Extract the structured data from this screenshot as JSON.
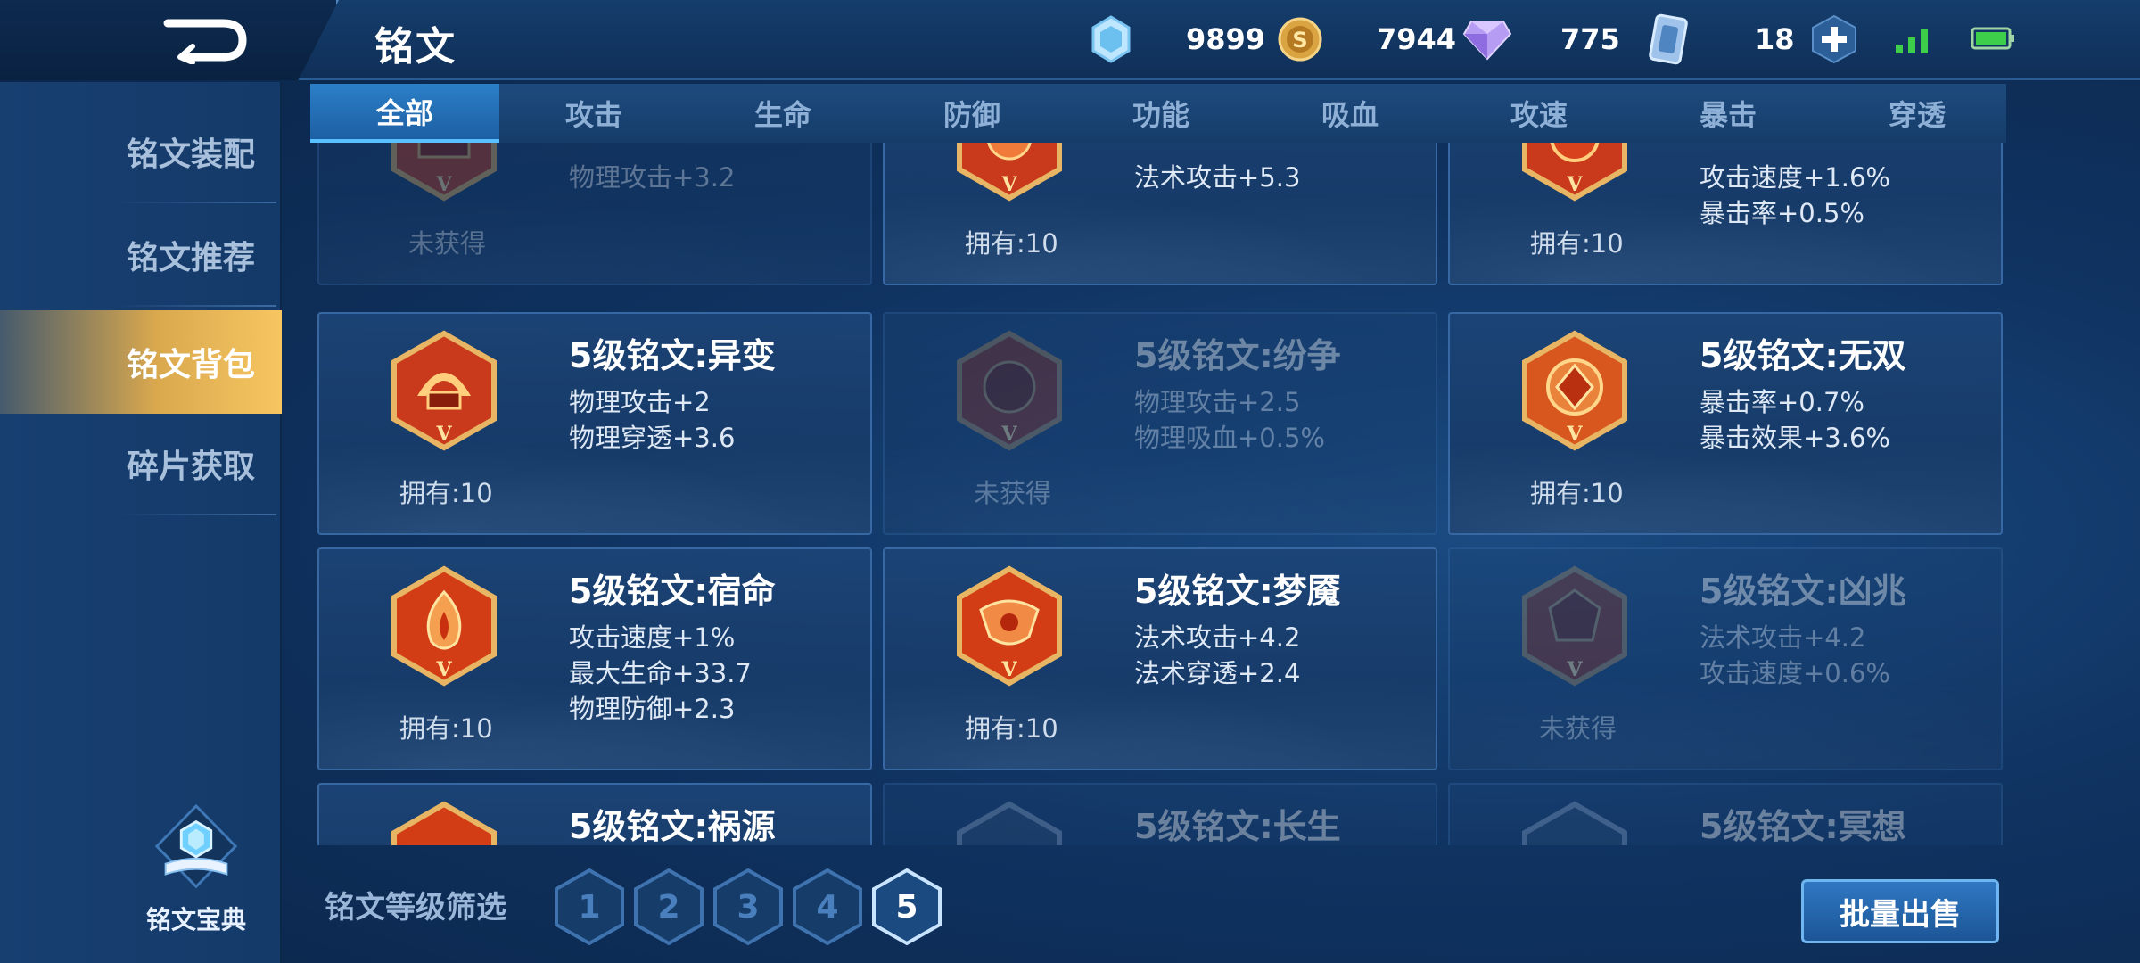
{
  "header": {
    "title": "铭文",
    "back_icon": "back-arrow-icon"
  },
  "resources": [
    {
      "icon": "crystal-icon",
      "value": "9899"
    },
    {
      "icon": "gold-coin-icon",
      "value": "7944"
    },
    {
      "icon": "diamond-icon",
      "value": "775"
    },
    {
      "icon": "ticket-card-icon",
      "value": "18"
    }
  ],
  "sidebar": {
    "items": [
      {
        "label": "铭文装配"
      },
      {
        "label": "铭文推荐"
      },
      {
        "label": "铭文背包"
      },
      {
        "label": "碎片获取"
      }
    ],
    "active_index": 2,
    "codex_label": "铭文宝典"
  },
  "tabs": [
    {
      "label": "全部"
    },
    {
      "label": "攻击"
    },
    {
      "label": "生命"
    },
    {
      "label": "防御"
    },
    {
      "label": "功能"
    },
    {
      "label": "吸血"
    },
    {
      "label": "攻速"
    },
    {
      "label": "暴击"
    },
    {
      "label": "穿透"
    }
  ],
  "cards": [
    {
      "name": "",
      "stats": [
        "物理攻击+3.2"
      ],
      "owned": "未获得",
      "locked": true
    },
    {
      "name": "",
      "stats": [
        "法术攻击+5.3"
      ],
      "owned": "拥有:10",
      "locked": false
    },
    {
      "name": "",
      "stats": [
        "攻击速度+1.6%",
        "暴击率+0.5%"
      ],
      "owned": "拥有:10",
      "locked": false
    },
    {
      "name": "5级铭文:异变",
      "stats": [
        "物理攻击+2",
        "物理穿透+3.6"
      ],
      "owned": "拥有:10",
      "locked": false
    },
    {
      "name": "5级铭文:纷争",
      "stats": [
        "物理攻击+2.5",
        "物理吸血+0.5%"
      ],
      "owned": "未获得",
      "locked": true
    },
    {
      "name": "5级铭文:无双",
      "stats": [
        "暴击率+0.7%",
        "暴击效果+3.6%"
      ],
      "owned": "拥有:10",
      "locked": false
    },
    {
      "name": "5级铭文:宿命",
      "stats": [
        "攻击速度+1%",
        "最大生命+33.7",
        "物理防御+2.3"
      ],
      "owned": "拥有:10",
      "locked": false
    },
    {
      "name": "5级铭文:梦魇",
      "stats": [
        "法术攻击+4.2",
        "法术穿透+2.4"
      ],
      "owned": "拥有:10",
      "locked": false
    },
    {
      "name": "5级铭文:凶兆",
      "stats": [
        "法术攻击+4.2",
        "攻击速度+0.6%"
      ],
      "owned": "未获得",
      "locked": true
    },
    {
      "name": "5级铭文:祸源",
      "stats": [],
      "owned": "",
      "locked": false
    },
    {
      "name": "5级铭文:长生",
      "stats": [],
      "owned": "",
      "locked": true
    },
    {
      "name": "5级铭文:冥想",
      "stats": [],
      "owned": "",
      "locked": true
    }
  ],
  "rune_icon_label": "V",
  "filter": {
    "label": "铭文等级筛选",
    "levels": [
      "1",
      "2",
      "3",
      "4",
      "5"
    ],
    "active_level": "5"
  },
  "actions": {
    "bulk_sell": "批量出售"
  },
  "colors": {
    "accent_blue": "#2b7fc7",
    "active_gold": "#f7c661",
    "rune_red": "#c93a1c",
    "rune_gold": "#e7b563"
  }
}
